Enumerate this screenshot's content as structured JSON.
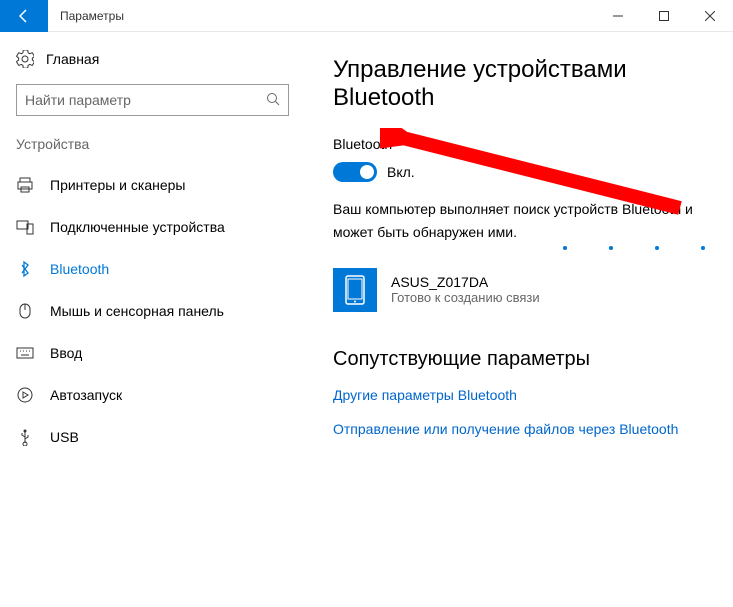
{
  "window": {
    "title": "Параметры"
  },
  "sidebar": {
    "home": "Главная",
    "search_placeholder": "Найти параметр",
    "section": "Устройства",
    "items": [
      {
        "label": "Принтеры и сканеры"
      },
      {
        "label": "Подключенные устройства"
      },
      {
        "label": "Bluetooth"
      },
      {
        "label": "Мышь и сенсорная панель"
      },
      {
        "label": "Ввод"
      },
      {
        "label": "Автозапуск"
      },
      {
        "label": "USB"
      }
    ]
  },
  "main": {
    "title": "Управление устройствами Bluetooth",
    "bt_label": "Bluetooth",
    "toggle_state": "Вкл.",
    "description_l1": "Ваш компьютер выполняет поиск устройств Bluetooth и",
    "description_l2": "может быть обнаружен ими.",
    "device": {
      "name": "ASUS_Z017DA",
      "status": "Готово к созданию связи"
    },
    "related_title": "Сопутствующие параметры",
    "links": [
      "Другие параметры Bluetooth",
      "Отправление или получение файлов через Bluetooth"
    ]
  }
}
